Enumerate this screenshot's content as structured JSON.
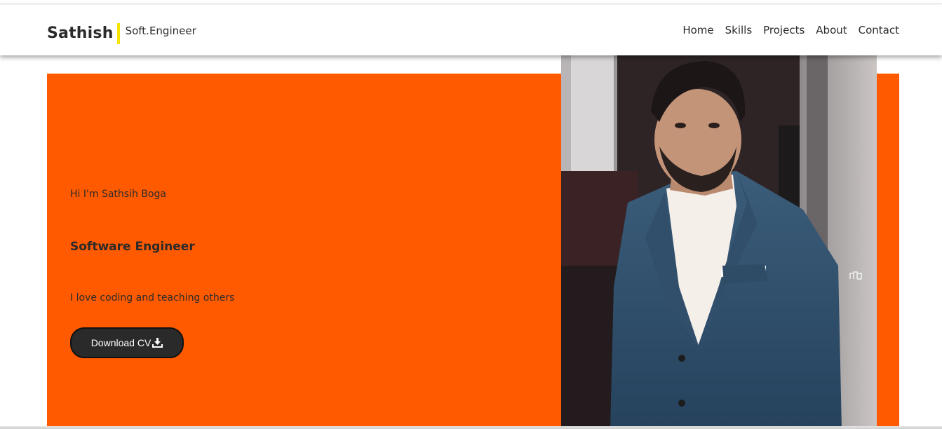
{
  "header": {
    "brand_name": "Sathish",
    "brand_subtitle": "Soft.Engineer",
    "nav": [
      "Home",
      "Skills",
      "Projects",
      "About",
      "Contact"
    ]
  },
  "hero": {
    "greeting": "Hi I'm Sathsih Boga",
    "role": "Software Engineer",
    "tagline": "I love coding and teaching others",
    "cv_button_label": "Download CV",
    "cv_button_icon": "download-icon"
  },
  "colors": {
    "accent_orange": "#ff5a00",
    "brand_bar_yellow": "#f5e400",
    "button_dark": "#2a2a2a"
  }
}
